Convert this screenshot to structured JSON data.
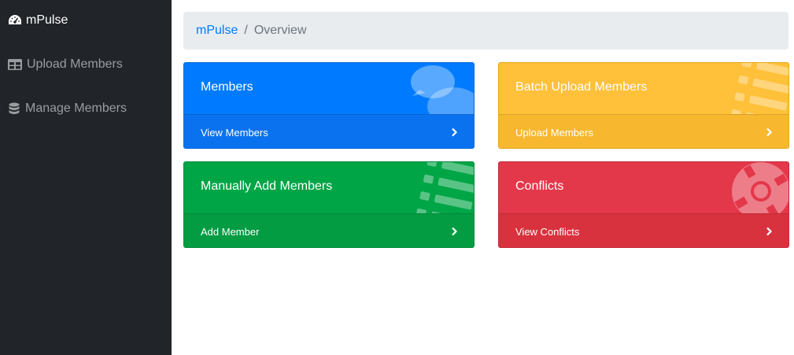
{
  "sidebar": {
    "brand": {
      "label": "mPulse",
      "icon": "tachometer-icon"
    },
    "items": [
      {
        "label": "Upload Members",
        "icon": "table-icon"
      },
      {
        "label": "Manage Members",
        "icon": "database-icon"
      }
    ]
  },
  "breadcrumb": {
    "home": "mPulse",
    "separator": "/",
    "current": "Overview"
  },
  "cards": [
    {
      "title": "Members",
      "footer": "View Members",
      "icon": "comments-icon",
      "color": "#007bff"
    },
    {
      "title": "Batch Upload Members",
      "footer": "Upload Members",
      "icon": "list-icon",
      "color": "#ffc107"
    },
    {
      "title": "Manually Add Members",
      "footer": "Add Member",
      "icon": "list-icon",
      "color": "#28a745"
    },
    {
      "title": "Conflicts",
      "footer": "View Conflicts",
      "icon": "life-ring-icon",
      "color": "#dc3545"
    }
  ]
}
